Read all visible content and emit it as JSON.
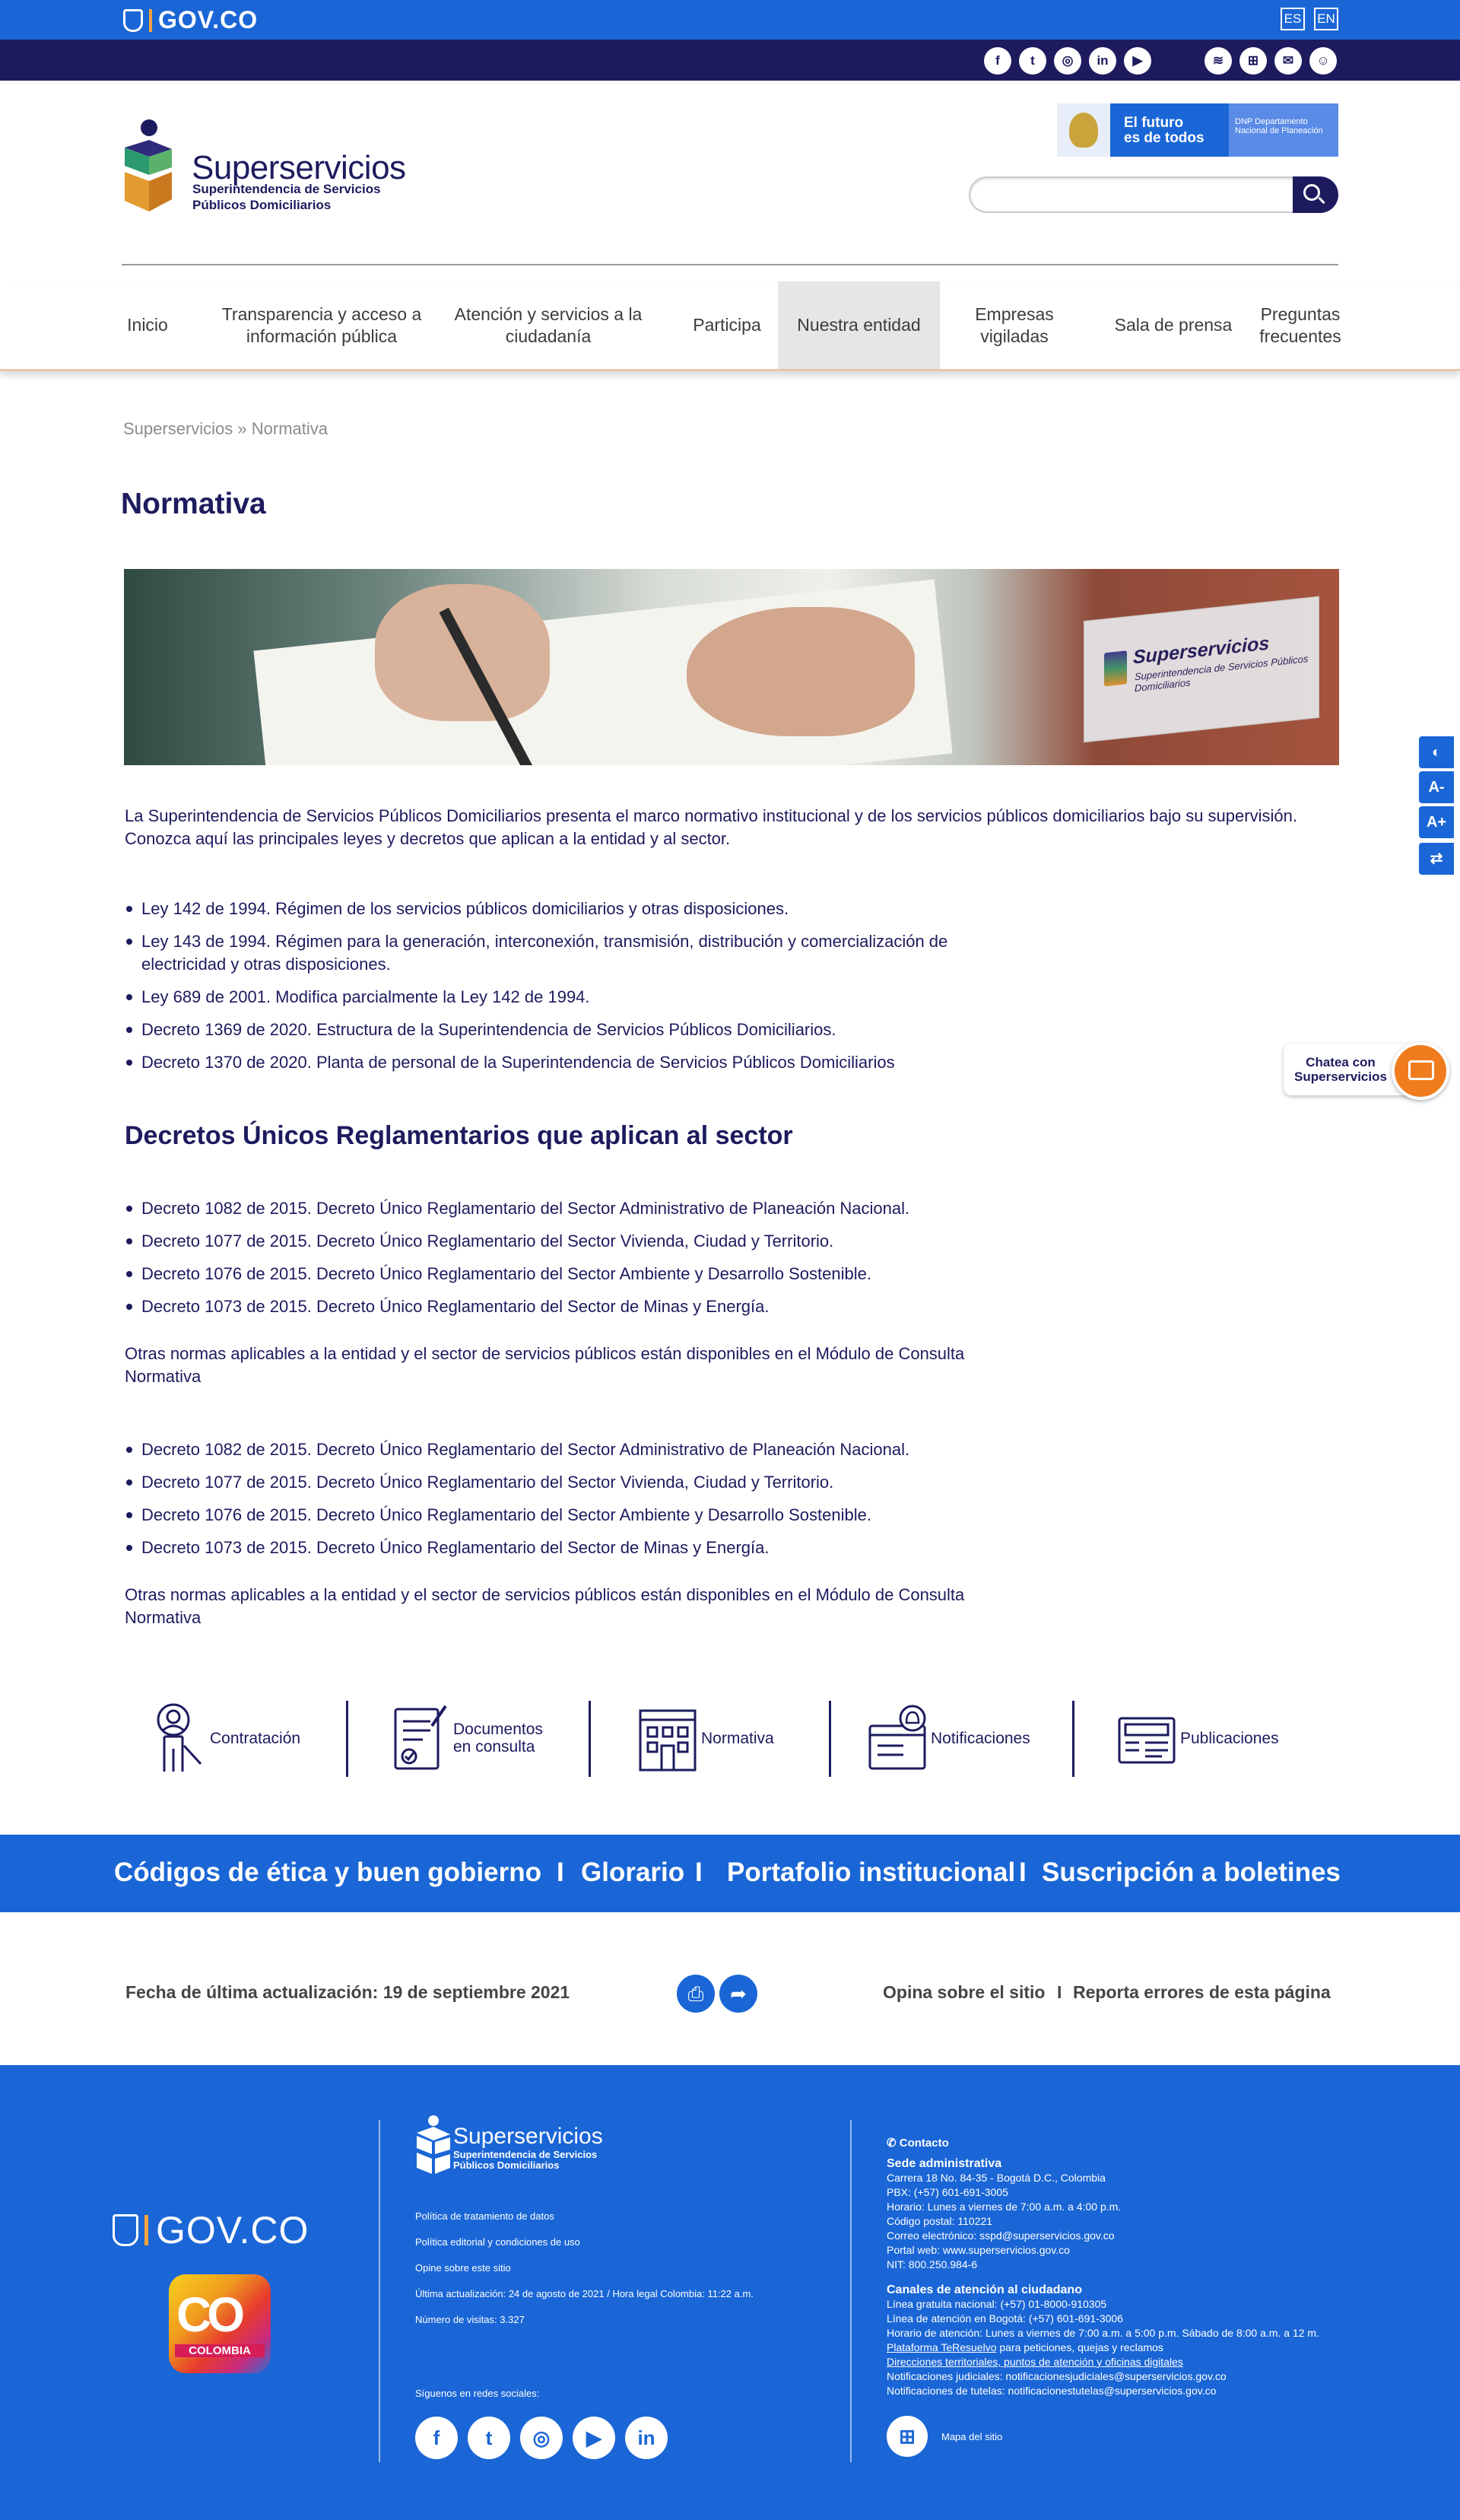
{
  "govbar": {
    "logo_text": "GOV.CO",
    "lang_es": "ES",
    "lang_en": "EN"
  },
  "socialbar": {
    "social_icons": [
      "facebook-icon",
      "twitter-icon",
      "instagram-icon",
      "linkedin-icon",
      "youtube-icon"
    ],
    "social_glyphs": [
      "f",
      "t",
      "◎",
      "in",
      "▶"
    ],
    "util_icons": [
      "wifi-icon",
      "sitemap-icon",
      "mail-icon",
      "contact-icon"
    ],
    "util_glyphs": [
      "≋",
      "⊞",
      "✉",
      "☺"
    ]
  },
  "header": {
    "brand_name": "Superservicios",
    "brand_sub_1": "Superintendencia de Servicios",
    "brand_sub_2": "Públicos Domiciliarios",
    "dnp_line1": "El futuro",
    "dnp_line2": "es de todos",
    "dnp_dept": "DNP Departamento Nacional de Planeación",
    "search_placeholder": ""
  },
  "nav": {
    "items": [
      {
        "label": "Inicio"
      },
      {
        "label": "Transparencia y acceso a información pública"
      },
      {
        "label": "Atención y servicios a la ciudadanía"
      },
      {
        "label": "Participa"
      },
      {
        "label": "Nuestra entidad"
      },
      {
        "label": "Empresas vigiladas"
      },
      {
        "label": "Sala de prensa"
      },
      {
        "label": "Preguntas frecuentes"
      }
    ],
    "active": "Nuestra entidad"
  },
  "page": {
    "breadcrumb": "Superservicios » Normativa",
    "title": "Normativa",
    "hero_plate_name": "Superservicios",
    "hero_plate_sub": "Superintendencia de Servicios Públicos Domiciliarios",
    "intro": "La Superintendencia de Servicios Públicos Domiciliarios presenta el marco normativo institucional y de los servicios públicos domiciliarios bajo su supervisión. Conozca aquí las principales leyes y decretos que aplican a la entidad y al sector.",
    "laws": [
      "Ley 142 de 1994. Régimen de los servicios públicos domiciliarios y otras disposiciones.",
      "Ley 143 de 1994. Régimen para la generación, interconexión, transmisión, distribución y comercialización de electricidad y otras disposiciones.",
      "Ley 689 de 2001. Modifica parcialmente la Ley 142 de 1994.",
      "Decreto 1369 de 2020. Estructura de la Superintendencia de Servicios Públicos Domiciliarios.",
      "Decreto 1370 de 2020. Planta de personal de la Superintendencia de Servicios Públicos Domiciliarios"
    ],
    "section_title": "Decretos Únicos Reglamentarios que aplican al sector",
    "decrees": [
      "Decreto 1082 de 2015. Decreto Único Reglamentario del Sector Administrativo de Planeación Nacional.",
      "Decreto 1077 de 2015. Decreto Único Reglamentario del Sector Vivienda, Ciudad y Territorio.",
      "Decreto 1076 de 2015. Decreto Único Reglamentario del Sector Ambiente y Desarrollo Sostenible.",
      "Decreto 1073 de 2015. Decreto Único Reglamentario del Sector de Minas y Energía."
    ],
    "other_norms": "Otras normas aplicables a la entidad y el sector de servicios públicos están disponibles en el Módulo de Consulta Normativa"
  },
  "quicklinks": [
    {
      "label": "Contratación",
      "icon": "contract-person-icon"
    },
    {
      "label": "Documentos en consulta",
      "icon": "document-check-icon"
    },
    {
      "label": "Normativa",
      "icon": "building-icon"
    },
    {
      "label": "Notificaciones",
      "icon": "bell-window-icon"
    },
    {
      "label": "Publicaciones",
      "icon": "publication-icon"
    }
  ],
  "band": {
    "link1": "Códigos de ética y buen gobierno",
    "link2": "Glorario",
    "link3": "Portafolio institucional",
    "link4": "Suscripción a boletines",
    "sep": "I"
  },
  "update": {
    "last_update": "Fecha de última actualización: 19 de septiembre 2021",
    "opina": "Opina sobre el sitio",
    "sep": "I",
    "reporta": "Reporta errores de esta página"
  },
  "footer": {
    "gov": "GOV.CO",
    "colombia_co": "CO",
    "colombia_word": "COLOMBIA",
    "brand_name": "Superservicios",
    "brand_sub_1": "Superintendencia de Servicios",
    "brand_sub_2": "Públicos Domiciliarios",
    "links": [
      "Política de tratamiento de datos",
      "Política editorial y condiciones de uso",
      "Opine sobre este sitio",
      "Última actualización: 24 de agosto de 2021 / Hora legal Colombia: 11:22 a.m.",
      "Número de visitas: 3.327"
    ],
    "follow": "Síguenos en redes sociales:",
    "social_glyphs": [
      "f",
      "t",
      "◎",
      "▶",
      "in"
    ],
    "contact_title": "Contacto",
    "sede_title": "Sede administrativa",
    "sede_lines": [
      "Carrera 18 No. 84-35 - Bogotá D.C., Colombia",
      "PBX: (+57) 601-691-3005",
      "Horario: Lunes a viernes de 7:00 a.m. a 4:00 p.m.",
      "Código postal: 110221",
      "Correo electrónico: sspd@superservicios.gov.co",
      "Portal web: www.superservicios.gov.co",
      "NIT: 800.250.984-6"
    ],
    "canales_title": "Canales de atención al ciudadano",
    "canales_lines": [
      "Línea gratuita nacional: (+57) 01-8000-910305",
      "Línea de atención en Bogotá: (+57) 601-691-3006",
      "Horario de atención: Lunes a viernes de 7:00 a.m. a 5:00 p.m. Sábado de 8:00 a.m. a 12 m."
    ],
    "plataforma_link": "Plataforma TeResuelvo",
    "plataforma_rest": " para peticiones, quejas y reclamos",
    "direcciones_link": "Direcciones territoriales, puntos de atención y oficinas digitales",
    "notif_lines": [
      "Notificaciones judiciales: notificacionesjudiciales@superservicios.gov.co",
      "Notificaciones de tutelas: notificacionestutelas@superservicios.gov.co"
    ],
    "sitemap": "Mapa del sitio"
  },
  "side": {
    "acc_glyphs": [
      "◐",
      "A-",
      "A+",
      "⇄"
    ],
    "chat_line1": "Chatea con",
    "chat_line2": "Superservicios"
  },
  "colors": {
    "gov_blue": "#1a66d6",
    "navy": "#1d1b5e",
    "orange": "#f07c1d"
  }
}
